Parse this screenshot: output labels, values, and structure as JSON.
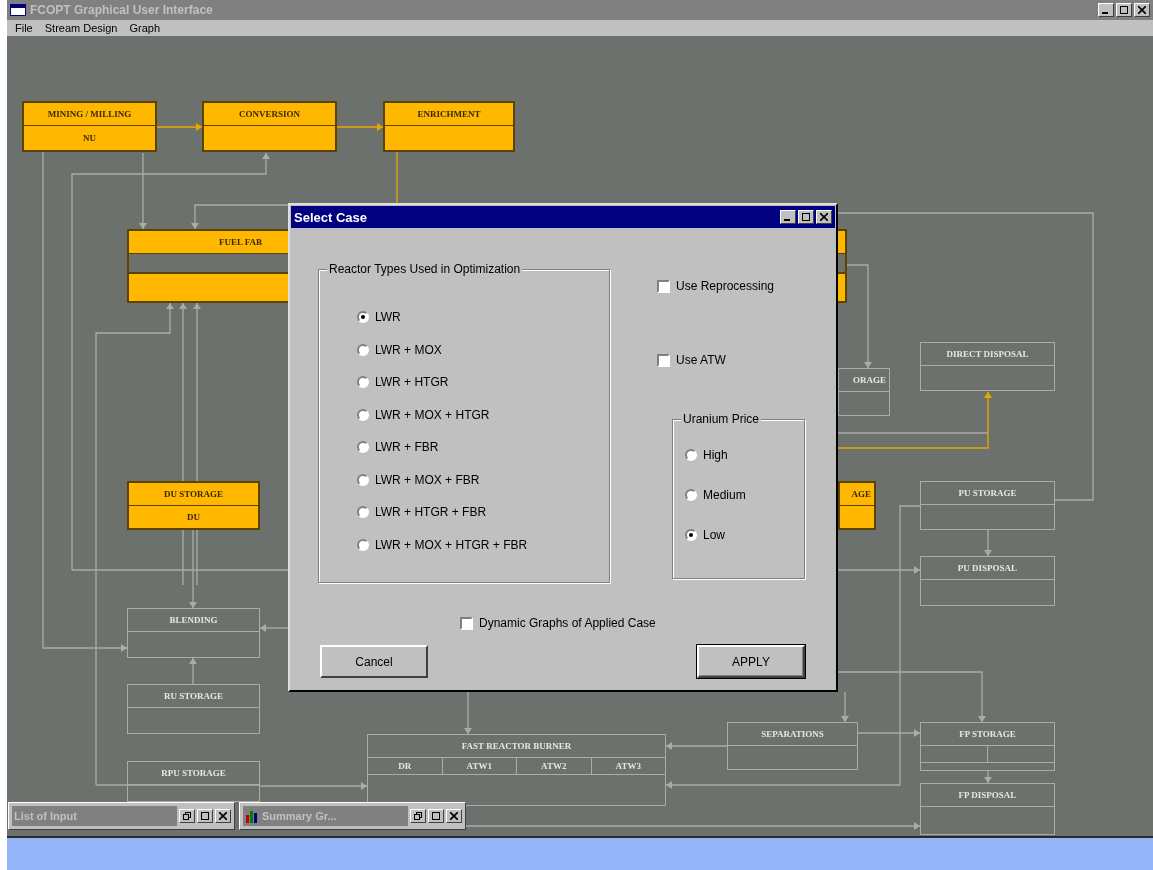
{
  "window": {
    "title": "FCOPT Graphical User Interface",
    "active": false
  },
  "menu": [
    {
      "label": "File"
    },
    {
      "label": "Stream Design"
    },
    {
      "label": "Graph"
    }
  ],
  "diagram": {
    "nodes": [
      {
        "label": "MINING / MILLING",
        "enabled": true,
        "kind": "plain",
        "cells": [
          "NU"
        ]
      },
      {
        "label": "CONVERSION",
        "enabled": true,
        "kind": "plain"
      },
      {
        "label": "ENRICHMENT",
        "enabled": true,
        "kind": "plain"
      },
      {
        "label": "FUEL FAB",
        "enabled": true,
        "kind": "fab"
      },
      {
        "label": "ORAGE",
        "enabled": false,
        "kind": "plain"
      },
      {
        "label": "DIRECT DISPOSAL",
        "enabled": false,
        "kind": "plain"
      },
      {
        "label": "DU STORAGE",
        "enabled": true,
        "kind": "plain",
        "cells": [
          "DU"
        ]
      },
      {
        "label": "AGE",
        "enabled": true,
        "kind": "plain"
      },
      {
        "label": "PU STORAGE",
        "enabled": false,
        "kind": "plain"
      },
      {
        "label": "PU DISPOSAL",
        "enabled": false,
        "kind": "plain"
      },
      {
        "label": "BLENDING",
        "enabled": false,
        "kind": "plain"
      },
      {
        "label": "RU STORAGE",
        "enabled": false,
        "kind": "plain"
      },
      {
        "label": "FAST REACTOR BURNER",
        "enabled": false,
        "kind": "plain",
        "cells": [
          "DR",
          "ATW1",
          "ATW2",
          "ATW3"
        ]
      },
      {
        "label": "SEPARATIONS",
        "enabled": false,
        "kind": "plain"
      },
      {
        "label": "FP STORAGE",
        "enabled": false,
        "kind": "split"
      },
      {
        "label": "RPU STORAGE",
        "enabled": false,
        "kind": "plain"
      },
      {
        "label": "FP DISPOSAL",
        "enabled": false,
        "kind": "plain"
      }
    ]
  },
  "dialog": {
    "title": "Select Case",
    "active": true,
    "reactor_group": {
      "label": "Reactor Types Used in Optimization",
      "options": [
        {
          "label": "LWR",
          "selected": true
        },
        {
          "label": "LWR + MOX",
          "selected": false
        },
        {
          "label": "LWR + HTGR",
          "selected": false
        },
        {
          "label": "LWR + MOX + HTGR",
          "selected": false
        },
        {
          "label": "LWR + FBR",
          "selected": false
        },
        {
          "label": "LWR + MOX + FBR",
          "selected": false
        },
        {
          "label": "LWR + HTGR + FBR",
          "selected": false
        },
        {
          "label": "LWR + MOX + HTGR + FBR",
          "selected": false
        }
      ]
    },
    "options": [
      {
        "label": "Use Reprocessing",
        "checked": false
      },
      {
        "label": "Use ATW",
        "checked": false
      }
    ],
    "price_group": {
      "label": "Uranium Price",
      "options": [
        {
          "label": "High",
          "selected": false
        },
        {
          "label": "Medium",
          "selected": false
        },
        {
          "label": "Low",
          "selected": true
        }
      ]
    },
    "dynamic_graphs": {
      "label": "Dynamic Graphs of Applied Case",
      "checked": false
    },
    "buttons": [
      {
        "label": "Cancel",
        "default": false
      },
      {
        "label": "APPLY",
        "default": true
      }
    ]
  },
  "minimized_windows": [
    {
      "title": "List of Input",
      "kind": "plain"
    },
    {
      "title": "Summary Gr...",
      "kind": "chart"
    }
  ]
}
